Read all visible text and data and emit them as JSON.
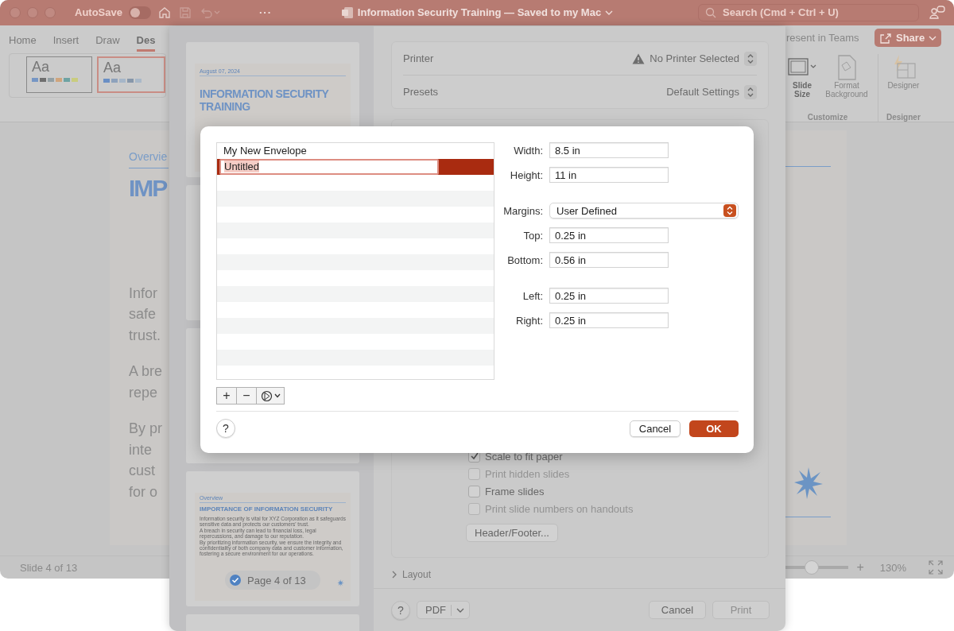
{
  "app": {
    "title_bar": {
      "autosave": {
        "label": "AutoSave",
        "on": false
      },
      "more": "···",
      "title": "Information Security Training — Saved to my Mac",
      "search": {
        "placeholder": "Search (Cmd + Ctrl + U)"
      }
    },
    "ribbon": {
      "tabs": [
        {
          "label": "Home",
          "selected": false
        },
        {
          "label": "Insert",
          "selected": false
        },
        {
          "label": "Draw",
          "selected": false
        },
        {
          "label": "Des",
          "selected": true
        }
      ],
      "themes": [
        {
          "label": "Aa",
          "selected": false,
          "swatches": [
            {
              "color": "#7696c4"
            },
            {
              "color": "#6f6f6f"
            },
            {
              "color": "#93a0a5"
            },
            {
              "color": "#d0a57c"
            },
            {
              "color": "#6ea3a3"
            },
            {
              "color": "#c9cc7e"
            }
          ]
        },
        {
          "label": "Aa",
          "selected": true,
          "swatches": [
            {
              "color": "#6a8fc4"
            },
            {
              "color": "#8ea2bc"
            },
            {
              "color": "#a6b6c8"
            },
            {
              "color": "#8797aa"
            },
            {
              "color": "#a9b8c8"
            }
          ]
        }
      ],
      "present_in_teams": "resent in Teams",
      "share": "Share",
      "groups": [
        {
          "label": "Customize",
          "buttons": [
            {
              "kind": "slide-size",
              "label": "Slide Size",
              "disabled": false
            },
            {
              "kind": "format-background",
              "label": "Format Background",
              "disabled": true
            }
          ]
        },
        {
          "label": "Designer",
          "buttons": [
            {
              "kind": "designer",
              "label": "Designer",
              "disabled": true
            }
          ]
        }
      ]
    },
    "slide": {
      "section": "Overvie",
      "title": "IMP",
      "paragraphs": [
        [
          "Infor",
          "safe",
          "trust."
        ],
        [
          "A bre",
          "repe"
        ],
        [
          "By pr",
          "inte",
          "cust",
          "for o"
        ]
      ]
    },
    "status_bar": {
      "slide": "Slide 4 of 13",
      "zoom": {
        "level": 0.45,
        "plus": "+",
        "reading": "130%"
      }
    }
  },
  "print": {
    "thumbnails": [
      {
        "kind": "title",
        "date": "August 07, 2024",
        "title": "INFORMATION SECURITY TRAINING"
      },
      {
        "kind": "blank"
      },
      {
        "kind": "blank"
      },
      {
        "kind": "content",
        "section": "Overview",
        "title": "IMPORTANCE OF INFORMATION SECURITY",
        "paragraphs": [
          "Information security is vital for XYZ Corporation as it safeguards sensitive data and protects our customers' trust.",
          "A breach in security can lead to financial loss, legal repercussions, and damage to our reputation.",
          "By prioritizing information security, we ensure the integrity and confidentiality of both company data and customer information, fostering a secure environment for our operations."
        ]
      },
      {
        "kind": "blank"
      }
    ],
    "page_badge": "Page 4 of 13",
    "settings": [
      {
        "label": "Printer",
        "value": "No Printer Selected",
        "warning": true
      },
      {
        "label": "Presets",
        "value": "Default Settings",
        "warning": false
      }
    ],
    "options": [
      {
        "label": "Scale to fit paper",
        "checked": true,
        "disabled": false
      },
      {
        "label": "Print hidden slides",
        "checked": false,
        "disabled": true
      },
      {
        "label": "Frame slides",
        "checked": false,
        "disabled": false
      },
      {
        "label": "Print slide numbers on handouts",
        "checked": false,
        "disabled": true
      }
    ],
    "header_footer": "Header/Footer...",
    "layout": "Layout",
    "help": "?",
    "pdf": "PDF",
    "cancel": "Cancel",
    "print": {
      "label": "Print",
      "disabled": true
    }
  },
  "paper_dialog": {
    "paper_sizes": [
      {
        "name": "My New Envelope",
        "selected": false,
        "editing": false
      },
      {
        "name": "Untitled",
        "selected": true,
        "editing": true
      }
    ],
    "tools": [
      "+",
      "−"
    ],
    "field_groups": [
      [
        {
          "kind": "input",
          "label": "Width:",
          "value": "8.5 in"
        },
        {
          "kind": "input",
          "label": "Height:",
          "value": "11 in"
        }
      ],
      [
        {
          "kind": "select",
          "label": "Margins:",
          "value": "User Defined"
        },
        {
          "kind": "input",
          "label": "Top:",
          "value": "0.25 in"
        },
        {
          "kind": "input",
          "label": "Bottom:",
          "value": "0.56 in"
        }
      ],
      [
        {
          "kind": "input",
          "label": "Left:",
          "value": "0.25 in"
        },
        {
          "kind": "input",
          "label": "Right:",
          "value": "0.25 in"
        }
      ]
    ],
    "help": "?",
    "cancel": "Cancel",
    "ok": "OK"
  }
}
